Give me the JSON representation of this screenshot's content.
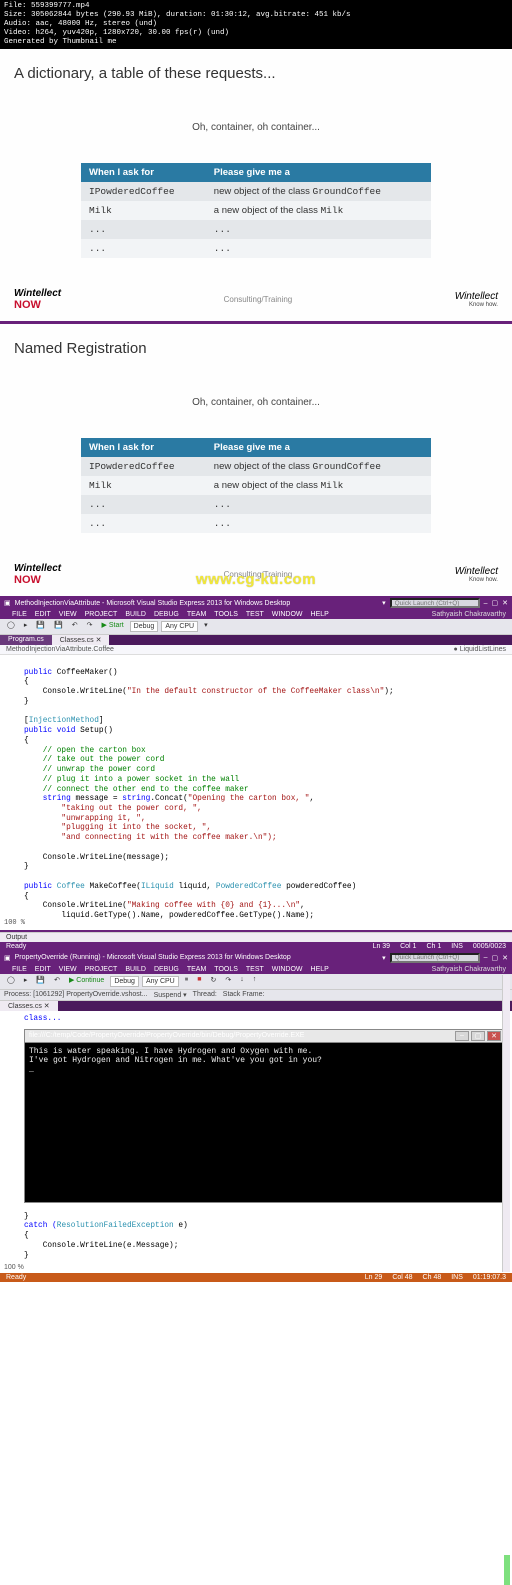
{
  "meta": {
    "file": "File: 559399777.mp4",
    "size": "Size: 305062844 bytes (290.93 MiB), duration: 01:30:12, avg.bitrate: 451 kb/s",
    "audio": "Audio: aac, 48000 Hz, stereo (und)",
    "video": "Video: h264, yuv420p, 1280x720, 30.00 fps(r) (und)",
    "gen": "Generated by Thumbnail me"
  },
  "slide1": {
    "title": "A dictionary, a table of these requests...",
    "sub": "Oh, container, oh container...",
    "th1": "When I ask for",
    "th2": "Please give me a",
    "r1": {
      "ask": "IPowderedCoffee",
      "give_pre": "new object of the class ",
      "give_mono": "GroundCoffee"
    },
    "r2": {
      "ask": "Milk",
      "give_pre": "a new object of the class ",
      "give_mono": "Milk"
    },
    "dots": "...",
    "brand_ct": "Consulting/Training",
    "brand_w": "Wintellect",
    "brand_now": "NOW",
    "brand_kh": "Know how."
  },
  "slide2": {
    "title": "Named Registration",
    "sub": "Oh, container, oh container...",
    "watermark": "www.cg-ku.com"
  },
  "vs1": {
    "title": "MethodInjectionViaAttribute - Microsoft Visual Studio Express 2013 for Windows Desktop",
    "ql": "Quick Launch (Ctrl+Q)",
    "user": "Sathyaish Chakravarthy",
    "menu": [
      "FILE",
      "EDIT",
      "VIEW",
      "PROJECT",
      "BUILD",
      "DEBUG",
      "TEAM",
      "TOOLS",
      "TEST",
      "WINDOW",
      "HELP"
    ],
    "config": "Debug",
    "cpu": "Any CPU",
    "start": "Start",
    "tabs": {
      "active": "Classes.cs",
      "inactive": "Program.cs"
    },
    "crumb_l": "MethodInjectionViaAttribute.Coffee",
    "crumb_r": "● LiquidListLines",
    "code": {
      "l1a": "public",
      "l1b": " CoffeeMaker()",
      "l2": "{",
      "l3a": "    Console.WriteLine(",
      "l3b": "\"In the default constructor of the CoffeeMaker class\\n\"",
      "l3c": ");",
      "l4": "}",
      "l5": "",
      "l6a": "[",
      "l6b": "InjectionMethod",
      "l6c": "]",
      "l7a": "public void",
      "l7b": " Setup()",
      "l8": "{",
      "c1": "    // open the carton box",
      "c2": "    // take out the power cord",
      "c3": "    // unwrap the power cord",
      "c4": "    // plug it into a power socket in the wall",
      "c5": "    // connect the other end to the coffee maker",
      "l9a": "    string",
      "l9b": " message = ",
      "l9c": "string",
      "l9d": ".Concat(",
      "l9e": "\"Opening the carton box, \"",
      "l9f": ",",
      "l10": "        \"taking out the power cord, \",",
      "l11": "        \"unwrapping it, \",",
      "l12": "        \"plugging it into the socket, \",",
      "l13": "        \"and connecting it with the coffee maker.\\n\");",
      "l14": "",
      "l15": "    Console.WriteLine(message);",
      "l16": "}",
      "l17": "",
      "l18a": "public ",
      "l18b": "Coffee",
      "l18c": " MakeCoffee(",
      "l18d": "ILiquid",
      "l18e": " liquid, ",
      "l18f": "PowderedCoffee",
      "l18g": " powderedCoffee)",
      "l19": "{",
      "l20a": "    Console.WriteLine(",
      "l20b": "\"Making coffee with {0} and {1}...\\n\"",
      "l20c": ",",
      "l21": "        liquid.GetType().Name, powderedCoffee.GetType().Name);"
    },
    "out": "Output",
    "status": {
      "ready": "Ready",
      "ln": "Ln 39",
      "col": "Col 1",
      "ch": "Ch 1",
      "ins": "INS",
      "badge": "0005/0023"
    },
    "zoom": "100 %"
  },
  "vs2": {
    "title": "PropertyOverride (Running) - Microsoft Visual Studio Express 2013 for Windows Desktop",
    "ql": "Quick Launch (Ctrl+Q)",
    "user": "Sathyaish Chakravarthy",
    "menu": [
      "FILE",
      "EDIT",
      "VIEW",
      "PROJECT",
      "BUILD",
      "DEBUG",
      "TEAM",
      "TOOLS",
      "TEST",
      "WINDOW",
      "HELP"
    ],
    "cont": "Continue",
    "config": "Debug",
    "cpu": "Any CPU",
    "proc": "Process: [1061292] PropertyOverride.vshost...",
    "susp": "Suspend ▾",
    "thr": "Thread:",
    "sf": "Stack Frame:",
    "tab": "Classes.cs",
    "pre": {
      "l1": "class..."
    },
    "console_title": "file:///C:/temp/Code/PropertyOverride/PropertyOverride/bin/Debug/PropertyOverride.EXE",
    "console_body": "This is water speaking. I have Hydrogen and Oxygen with me.\nI've got Hydrogen and Nitrogen in me. What've you got in you?\n_",
    "post": {
      "l1": "}",
      "l2a": "catch (",
      "l2b": "ResolutionFailedException",
      "l2c": " e)",
      "l3": "{",
      "l4": "    Console.WriteLine(e.Message);",
      "l5": "}"
    },
    "status": {
      "ready": "Ready",
      "ln": "Ln 29",
      "col": "Col 48",
      "ch": "Ch 48",
      "ins": "INS",
      "badge": "01:19:07.3"
    },
    "zoom": "100 %"
  }
}
